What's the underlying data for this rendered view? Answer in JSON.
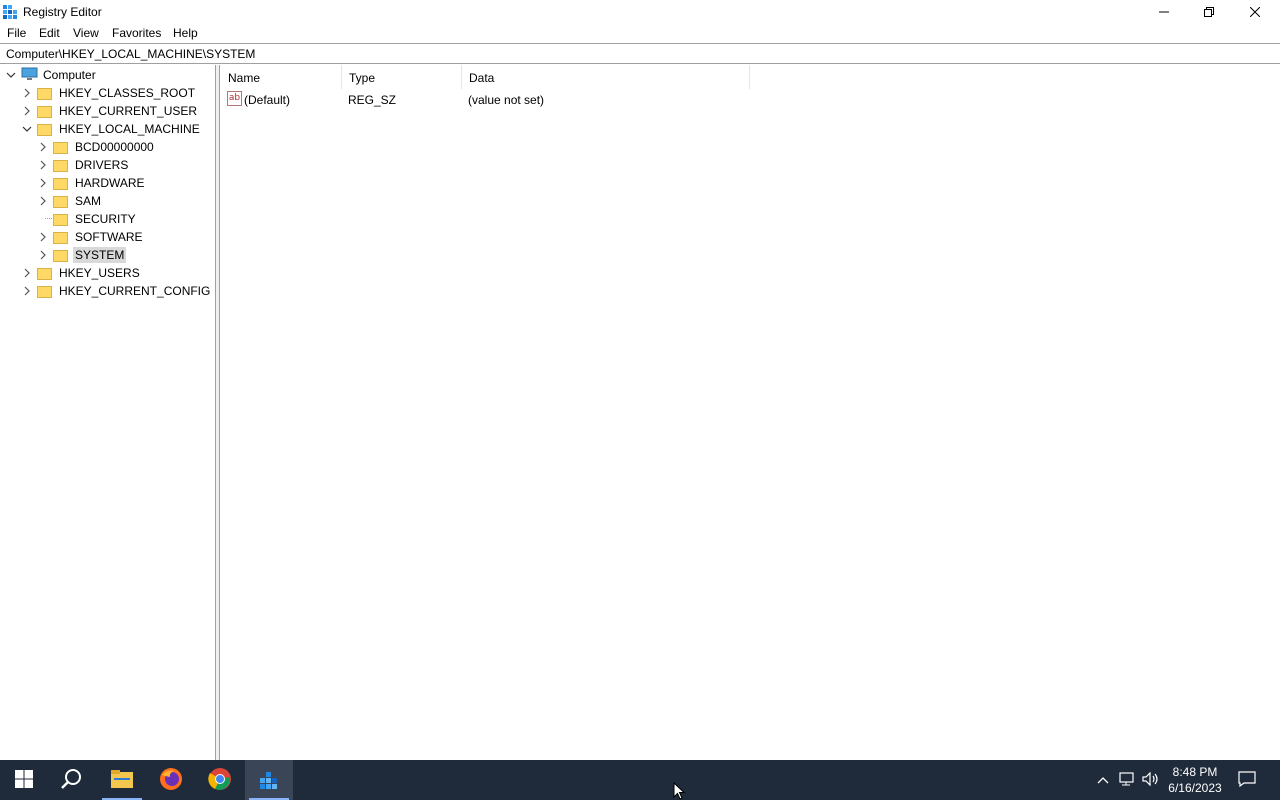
{
  "window": {
    "title": "Registry Editor"
  },
  "menu": [
    "File",
    "Edit",
    "View",
    "Favorites",
    "Help"
  ],
  "address": "Computer\\HKEY_LOCAL_MACHINE\\SYSTEM",
  "tree": {
    "root": "Computer",
    "hives": [
      "HKEY_CLASSES_ROOT",
      "HKEY_CURRENT_USER",
      "HKEY_LOCAL_MACHINE",
      "HKEY_USERS",
      "HKEY_CURRENT_CONFIG"
    ],
    "hklm_children": [
      "BCD00000000",
      "DRIVERS",
      "HARDWARE",
      "SAM",
      "SECURITY",
      "SOFTWARE",
      "SYSTEM"
    ],
    "selected": "SYSTEM"
  },
  "list": {
    "columns": [
      "Name",
      "Type",
      "Data"
    ],
    "rows": [
      {
        "name": "(Default)",
        "type": "REG_SZ",
        "data": "(value not set)",
        "icon": "string-value-icon"
      }
    ]
  },
  "taskbar": {
    "apps": [
      "start-icon",
      "search-icon",
      "file-explorer-icon",
      "firefox-icon",
      "chrome-icon",
      "registry-editor-icon"
    ],
    "active_app": "registry-editor-icon",
    "time": "8:48 PM",
    "date": "6/16/2023"
  },
  "colors": {
    "taskbar": "#1f2a3a",
    "folder": "#ffd966",
    "selection": "#d9d9d9"
  }
}
